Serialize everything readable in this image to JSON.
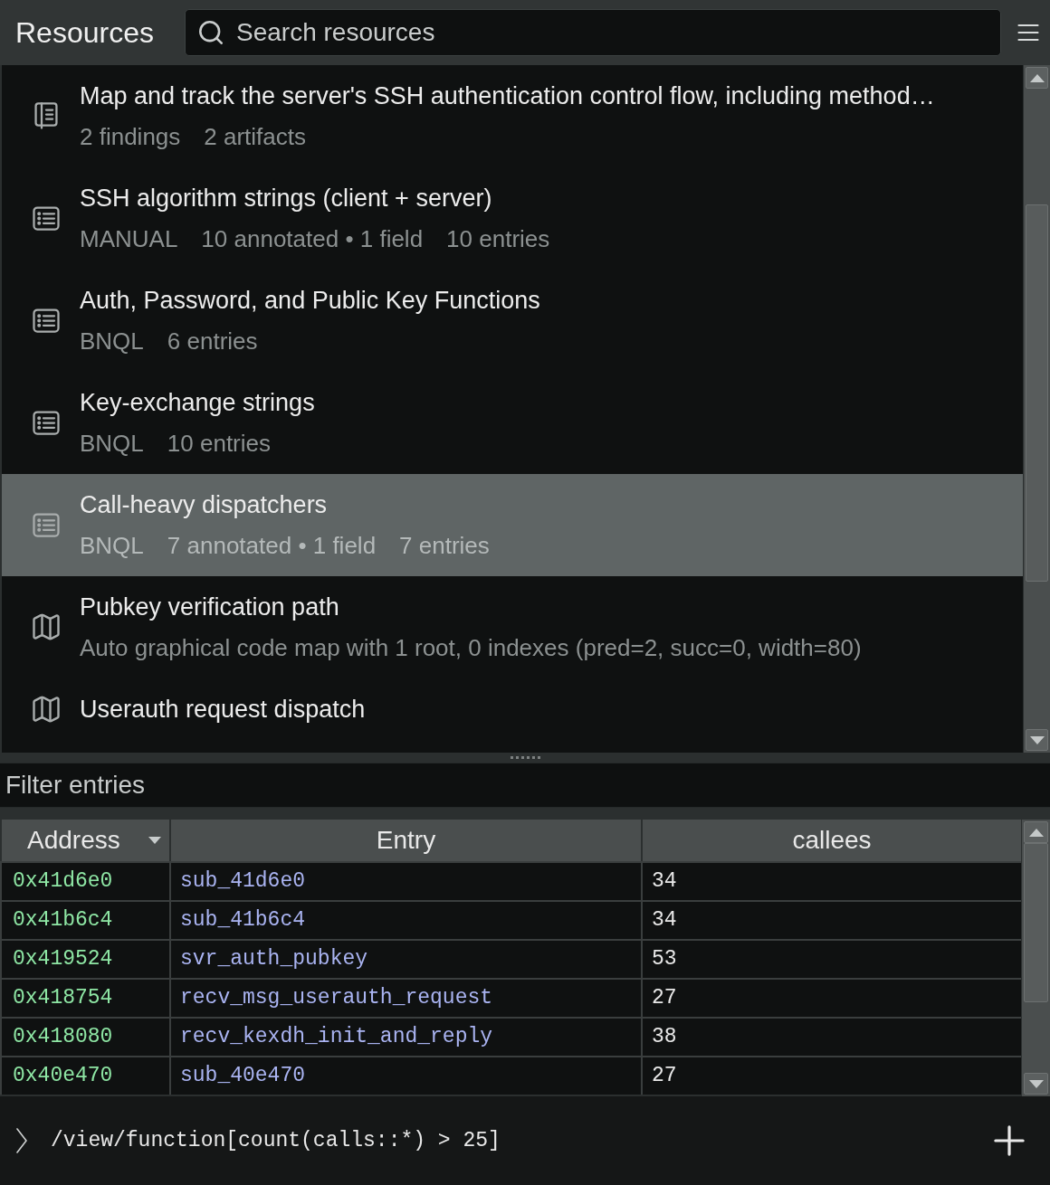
{
  "header": {
    "title": "Resources",
    "search": {
      "placeholder": "Search resources"
    }
  },
  "resources": {
    "items": [
      {
        "kind": "notebook",
        "title": "Map and track the server's SSH authentication control flow, including method…",
        "meta": [
          "2 findings",
          "2 artifacts"
        ],
        "selected": false
      },
      {
        "kind": "list",
        "title": "SSH algorithm strings (client + server)",
        "meta": [
          "MANUAL",
          "10 annotated • 1 field",
          "10 entries"
        ],
        "selected": false
      },
      {
        "kind": "list",
        "title": "Auth, Password, and Public Key Functions",
        "meta": [
          "BNQL",
          "6 entries"
        ],
        "selected": false
      },
      {
        "kind": "list",
        "title": "Key-exchange strings",
        "meta": [
          "BNQL",
          "10 entries"
        ],
        "selected": false
      },
      {
        "kind": "list",
        "title": "Call-heavy dispatchers",
        "meta": [
          "BNQL",
          "7 annotated • 1 field",
          "7 entries"
        ],
        "selected": true
      },
      {
        "kind": "map",
        "title": "Pubkey verification path",
        "meta": [
          "Auto graphical code map with 1 root, 0 indexes (pred=2, succ=0, width=80)"
        ],
        "selected": false
      },
      {
        "kind": "map",
        "title": "Userauth request dispatch",
        "selected": false
      }
    ]
  },
  "filter": {
    "placeholder": "Filter entries"
  },
  "table": {
    "columns": [
      {
        "label": "Address",
        "sorted": true
      },
      {
        "label": "Entry",
        "sorted": false
      },
      {
        "label": "callees",
        "sorted": false
      }
    ],
    "rows": [
      {
        "address": "0x41d6e0",
        "entry": "sub_41d6e0",
        "callees": "34"
      },
      {
        "address": "0x41b6c4",
        "entry": "sub_41b6c4",
        "callees": "34"
      },
      {
        "address": "0x419524",
        "entry": "svr_auth_pubkey",
        "callees": "53"
      },
      {
        "address": "0x418754",
        "entry": "recv_msg_userauth_request",
        "callees": "27"
      },
      {
        "address": "0x418080",
        "entry": "recv_kexdh_init_and_reply",
        "callees": "38"
      },
      {
        "address": "0x40e470",
        "entry": "sub_40e470",
        "callees": "27"
      }
    ]
  },
  "query_bar": {
    "query": "/view/function[count(calls::*) > 25]"
  }
}
